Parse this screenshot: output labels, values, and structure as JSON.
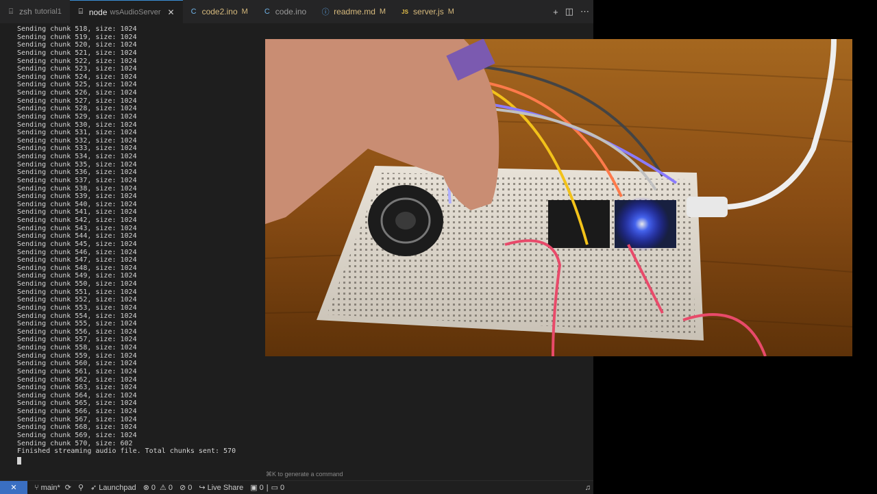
{
  "tabs": [
    {
      "icon": "terminal-icon",
      "glyph": "⌸",
      "label": "zsh",
      "sub": "tutorial1",
      "active": false
    },
    {
      "icon": "terminal-icon",
      "glyph": "⌸",
      "label": "node",
      "sub": "wsAudioServer",
      "active": true,
      "close": "✕"
    },
    {
      "icon": "c-file-icon",
      "glyph": "C",
      "label": "code2.ino",
      "mod": "M"
    },
    {
      "icon": "c-file-icon",
      "glyph": "C",
      "label": "code.ino"
    },
    {
      "icon": "info-icon",
      "glyph": "ⓘ",
      "label": "readme.md",
      "mod": "M"
    },
    {
      "icon": "js-file-icon",
      "glyph": "JS",
      "label": "server.js",
      "mod": "M"
    }
  ],
  "tab_actions": {
    "add": "+",
    "split": "◫",
    "more": "⋯"
  },
  "terminal": {
    "lines": [
      "Sending chunk 518, size: 1024",
      "Sending chunk 519, size: 1024",
      "Sending chunk 520, size: 1024",
      "Sending chunk 521, size: 1024",
      "Sending chunk 522, size: 1024",
      "Sending chunk 523, size: 1024",
      "Sending chunk 524, size: 1024",
      "Sending chunk 525, size: 1024",
      "Sending chunk 526, size: 1024",
      "Sending chunk 527, size: 1024",
      "Sending chunk 528, size: 1024",
      "Sending chunk 529, size: 1024",
      "Sending chunk 530, size: 1024",
      "Sending chunk 531, size: 1024",
      "Sending chunk 532, size: 1024",
      "Sending chunk 533, size: 1024",
      "Sending chunk 534, size: 1024",
      "Sending chunk 535, size: 1024",
      "Sending chunk 536, size: 1024",
      "Sending chunk 537, size: 1024",
      "Sending chunk 538, size: 1024",
      "Sending chunk 539, size: 1024",
      "Sending chunk 540, size: 1024",
      "Sending chunk 541, size: 1024",
      "Sending chunk 542, size: 1024",
      "Sending chunk 543, size: 1024",
      "Sending chunk 544, size: 1024",
      "Sending chunk 545, size: 1024",
      "Sending chunk 546, size: 1024",
      "Sending chunk 547, size: 1024",
      "Sending chunk 548, size: 1024",
      "Sending chunk 549, size: 1024",
      "Sending chunk 550, size: 1024",
      "Sending chunk 551, size: 1024",
      "Sending chunk 552, size: 1024",
      "Sending chunk 553, size: 1024",
      "Sending chunk 554, size: 1024",
      "Sending chunk 555, size: 1024",
      "Sending chunk 556, size: 1024",
      "Sending chunk 557, size: 1024",
      "Sending chunk 558, size: 1024",
      "Sending chunk 559, size: 1024",
      "Sending chunk 560, size: 1024",
      "Sending chunk 561, size: 1024",
      "Sending chunk 562, size: 1024",
      "Sending chunk 563, size: 1024",
      "Sending chunk 564, size: 1024",
      "Sending chunk 565, size: 1024",
      "Sending chunk 566, size: 1024",
      "Sending chunk 567, size: 1024",
      "Sending chunk 568, size: 1024",
      "Sending chunk 569, size: 1024",
      "Sending chunk 570, size: 602",
      "Finished streaming audio file. Total chunks sent: 570"
    ]
  },
  "hint": "⌘K to generate a command",
  "status": {
    "remote_glyph": "✕",
    "branch": "main*",
    "sync": "⟳",
    "launchpad": "Launchpad",
    "errors": "0",
    "warnings": "0",
    "ports": "0",
    "live_share": "Live Share",
    "count_a": "0",
    "count_b": "0"
  },
  "colors": {
    "accent": "#3a8fd6",
    "c_icon": "#6fb3e8",
    "js_icon": "#e8c34a",
    "info_icon": "#5aa0e0",
    "modified": "#d7ba7d",
    "remote_bg": "#3a6fc2"
  }
}
